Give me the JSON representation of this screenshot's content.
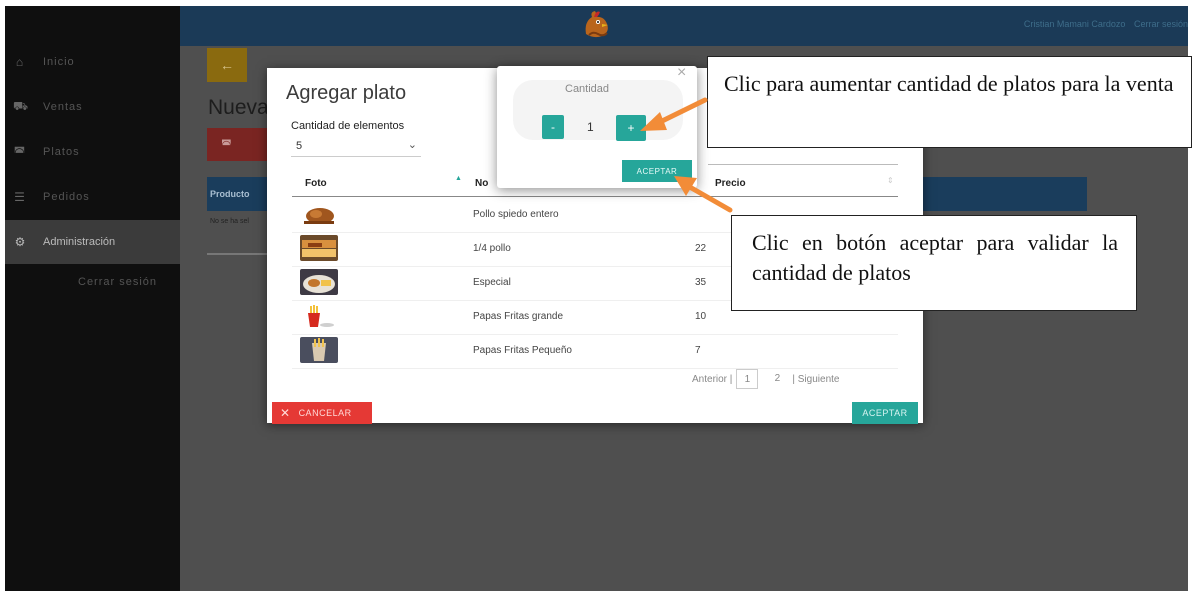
{
  "user": {
    "name": "Cristian Mamani Cardozo",
    "logout": "Cerrar sesión"
  },
  "sidebar": {
    "items": [
      {
        "label": "Inicio",
        "icon": "home-icon"
      },
      {
        "label": "Ventas",
        "icon": "cart-icon"
      },
      {
        "label": "Platos",
        "icon": "dish-icon"
      },
      {
        "label": "Pedidos",
        "icon": "list-icon"
      },
      {
        "label": "Administración",
        "icon": "admin-icon",
        "active": true
      }
    ],
    "logout": "Cerrar sesión"
  },
  "page": {
    "title": "Nueva",
    "table_header_product": "Producto",
    "empty_message": "No se ha sel"
  },
  "modal": {
    "title": "Agregar plato",
    "count_label": "Cantidad de elementos",
    "count_value": "5",
    "columns": {
      "photo": "Foto",
      "name": "No",
      "price": "Precio"
    },
    "rows": [
      {
        "name": "Pollo spiedo entero",
        "price": ""
      },
      {
        "name": "1/4 pollo",
        "price": "22"
      },
      {
        "name": "Especial",
        "price": "35"
      },
      {
        "name": "Papas Fritas grande",
        "price": "10"
      },
      {
        "name": "Papas Fritas Pequeño",
        "price": "7"
      }
    ],
    "pager": {
      "prev": "Anterior |",
      "pages": [
        "1",
        "2"
      ],
      "current": "1",
      "next": "| Siguiente"
    },
    "cancel": "CANCELAR",
    "accept": "ACEPTAR"
  },
  "quantity": {
    "title": "Cantidad",
    "minus": "-",
    "value": "1",
    "plus": "+",
    "accept": "ACEPTAR",
    "close": "×"
  },
  "callouts": {
    "plus_note": "Clic para aumentar cantidad de platos para la venta",
    "accept_note": "Clic en botón aceptar para validar la cantidad de platos"
  },
  "colors": {
    "accent": "#26a69a",
    "danger": "#e53935",
    "header": "#1b3a57",
    "arrow": "#f28c38"
  }
}
